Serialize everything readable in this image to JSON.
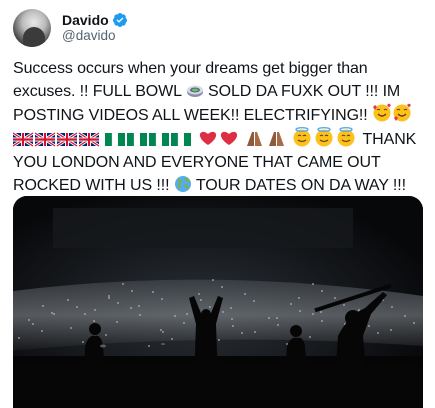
{
  "user": {
    "display_name": "Davido",
    "handle": "@davido",
    "verified": true
  },
  "tweet": {
    "line1": "Success occurs when your dreams get bigger than",
    "line2a": "excuses. !! FULL BOWL",
    "line2b": "SOLD DA FUXK OUT !!! IM",
    "line3a": "POSTING VIDEOS ALL WEEK!! ELECTRIFYING!!",
    "line4b": "THANK",
    "line5": "YOU LONDON AND EVERYONE THAT CAME OUT",
    "line6a": "ROCKED WITH US !!!",
    "line6b": "TOUR DATES ON  DA WAY !!!"
  },
  "icons": [
    "verified-badge-icon",
    "stadium-emoji",
    "smiling-hearts-emoji",
    "uk-flag-emoji",
    "nigeria-flag-emoji",
    "red-heart-emoji",
    "folded-hands-emoji",
    "halo-smile-emoji",
    "globe-emoji"
  ],
  "colors": {
    "text": "#0f1419",
    "secondary": "#536471",
    "verified": "#1d9bf0"
  }
}
